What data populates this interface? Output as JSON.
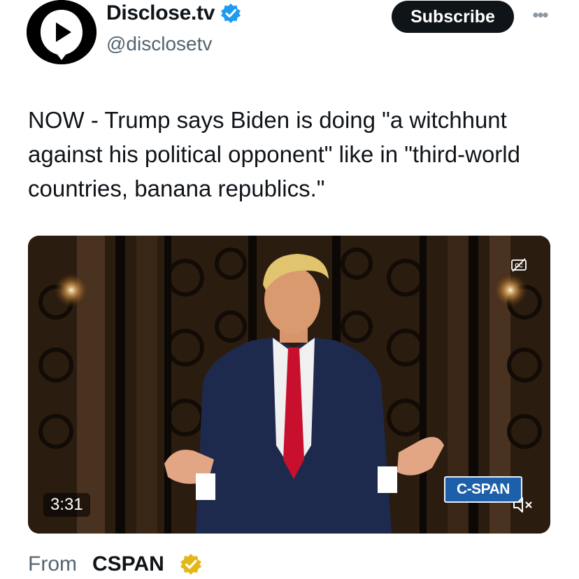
{
  "account": {
    "display_name": "Disclose.tv",
    "handle": "@disclosetv",
    "verified_badge": "blue-verified-icon",
    "avatar_icon": "play-shield-logo-icon"
  },
  "actions": {
    "subscribe_label": "Subscribe",
    "more_label": "•••"
  },
  "tweet": {
    "text": "NOW - Trump says Biden is doing \"a witchhunt against his political opponent\" like in \"third-world countries, banana republics.\""
  },
  "video": {
    "duration": "3:31",
    "broadcaster_logo": "C-SPAN",
    "controls": [
      "closed-captions-icon",
      "mute-icon"
    ]
  },
  "source": {
    "from_label": "From",
    "name": "CSPAN",
    "badge": "gold-verified-icon"
  },
  "colors": {
    "subscribe_bg": "#0f1419",
    "verified_blue": "#1d9bf0",
    "gold_badge": "#e2b719",
    "secondary_text": "#536471"
  }
}
